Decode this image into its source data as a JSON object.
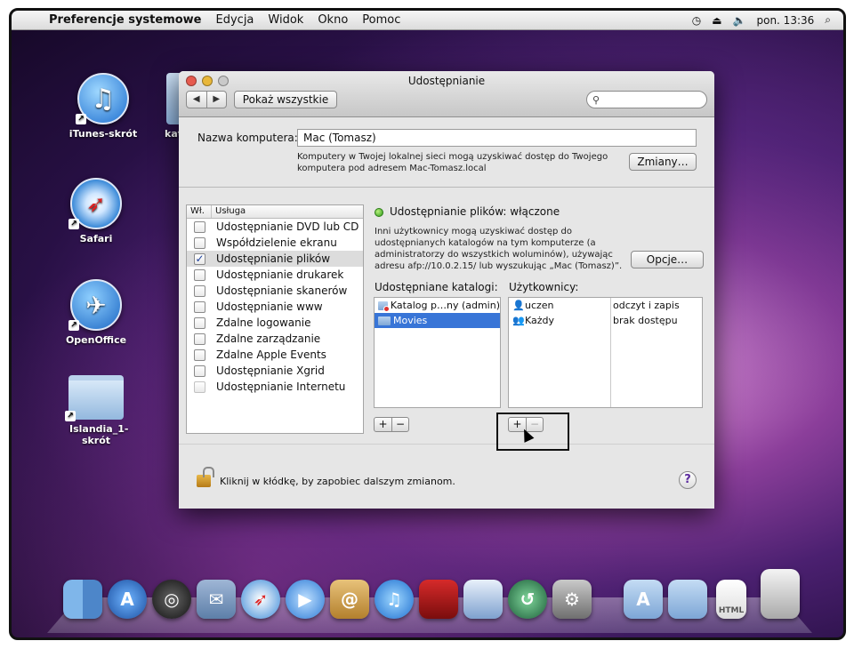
{
  "menubar": {
    "app_name": "Preferencje systemowe",
    "items": [
      "Edycja",
      "Widok",
      "Okno",
      "Pomoc"
    ],
    "clock": "pon. 13:36"
  },
  "desktop": {
    "icons": [
      {
        "label": "iTunes-skrót"
      },
      {
        "label": "Safari"
      },
      {
        "label": "OpenOffice"
      },
      {
        "label": "Islandia_1-skrót"
      },
      {
        "label": "kat"
      }
    ]
  },
  "window": {
    "title": "Udostępnianie",
    "show_all": "Pokaż wszystkie",
    "computer_name_label": "Nazwa komputera:",
    "computer_name_value": "Mac (Tomasz)",
    "computer_info": "Komputery w Twojej lokalnej sieci mogą uzyskiwać dostęp do Twojego komputera pod adresem Mac-Tomasz.local",
    "change_button": "Zmiany…",
    "services_header": {
      "col_on": "Wł.",
      "col_service": "Usługa"
    },
    "services": [
      {
        "label": "Udostępnianie DVD lub CD",
        "checked": false
      },
      {
        "label": "Współdzielenie ekranu",
        "checked": false
      },
      {
        "label": "Udostępnianie plików",
        "checked": true
      },
      {
        "label": "Udostępnianie drukarek",
        "checked": false
      },
      {
        "label": "Udostępnianie skanerów",
        "checked": false
      },
      {
        "label": "Udostępnianie www",
        "checked": false
      },
      {
        "label": "Zdalne logowanie",
        "checked": false
      },
      {
        "label": "Zdalne zarządzanie",
        "checked": false
      },
      {
        "label": "Zdalne Apple Events",
        "checked": false
      },
      {
        "label": "Udostępnianie Xgrid",
        "checked": false
      },
      {
        "label": "Udostępnianie Internetu",
        "checked": false
      }
    ],
    "status_text": "Udostępnianie plików: włączone",
    "status_description": "Inni użytkownicy mogą uzyskiwać dostęp do udostępnianych katalogów na tym komputerze (a administratorzy do wszystkich woluminów), używając adresu afp://10.0.2.15/ lub wyszukując „Mac (Tomasz)”.",
    "options_button": "Opcje…",
    "shared_folders_label": "Udostępniane katalogi:",
    "users_label": "Użytkownicy:",
    "shared_folders": [
      "Katalog p…ny (admin)",
      "Movies"
    ],
    "users": [
      {
        "name": "uczen",
        "access": "odczyt i zapis"
      },
      {
        "name": "Każdy",
        "access": "brak dostępu"
      }
    ],
    "lock_text": "Kliknij w kłódkę, by zapobiec dalszym zmianom.",
    "help": "?"
  },
  "colors": {
    "selection": "#3875d7",
    "status_green": "#2f9b1a"
  }
}
